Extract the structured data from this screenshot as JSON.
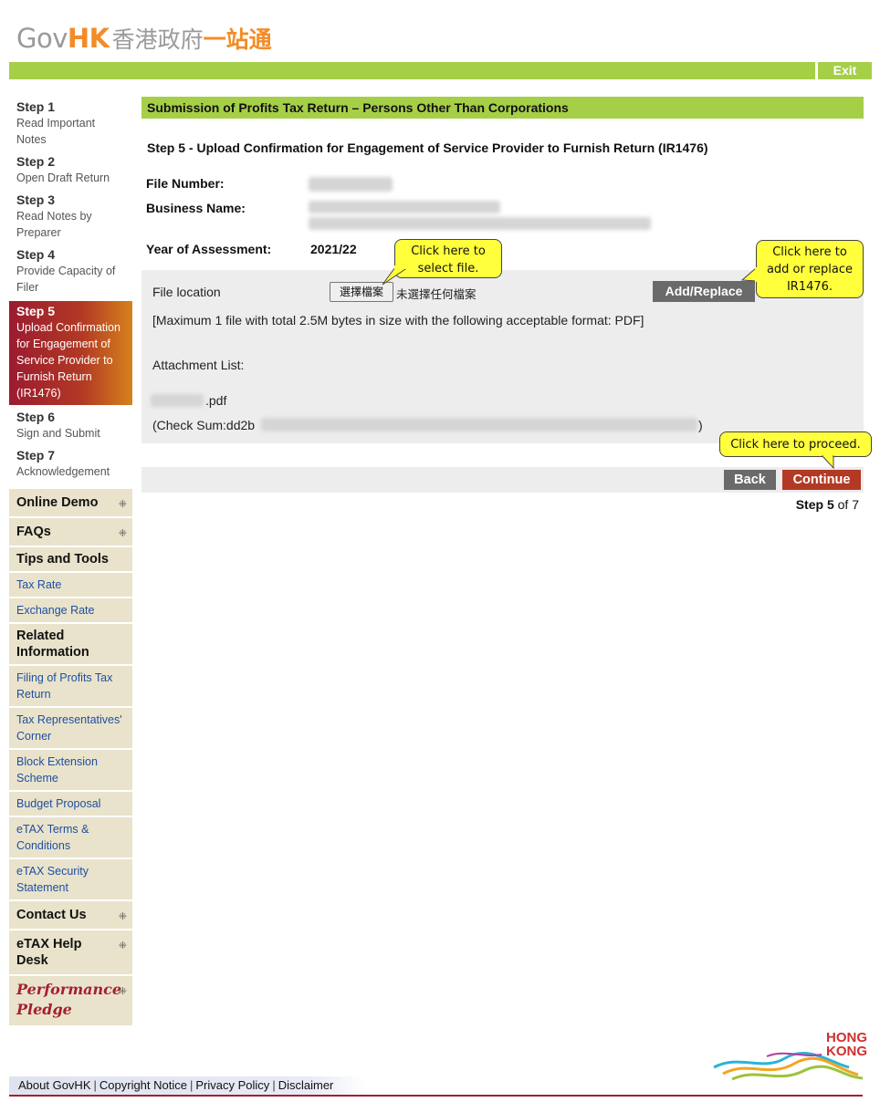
{
  "header": {
    "logo_gov": "Gov",
    "logo_hk": "HK",
    "logo_zh1": "香港政府",
    "logo_zh2": "一站通",
    "exit_label": "Exit"
  },
  "sidebar": {
    "steps": [
      {
        "num": "Step 1",
        "desc": "Read Important Notes"
      },
      {
        "num": "Step 2",
        "desc": "Open Draft Return"
      },
      {
        "num": "Step 3",
        "desc": "Read Notes by Preparer"
      },
      {
        "num": "Step 4",
        "desc": "Provide Capacity of Filer"
      },
      {
        "num": "Step 5",
        "desc": "Upload Confirmation for Engagement of Service Provider to Furnish Return (IR1476)"
      },
      {
        "num": "Step 6",
        "desc": "Sign and Submit"
      },
      {
        "num": "Step 7",
        "desc": "Acknowledgement"
      }
    ],
    "menu": {
      "online_demo": "Online Demo",
      "faqs": "FAQs",
      "tips_tools": "Tips and Tools",
      "tax_rate": "Tax Rate",
      "exchange_rate": "Exchange Rate",
      "related_info": "Related Information",
      "filing_profits": "Filing of Profits Tax Return",
      "tax_rep": "Tax Representatives' Corner",
      "block_ext": "Block Extension Scheme",
      "budget": "Budget Proposal",
      "etax_terms": "eTAX Terms & Conditions",
      "etax_security": "eTAX Security Statement",
      "contact": "Contact Us",
      "help_desk": "eTAX Help Desk",
      "pledge_line1": "Performance",
      "pledge_line2": "Pledge"
    }
  },
  "main": {
    "title": "Submission of Profits Tax Return – Persons Other Than Corporations",
    "step_heading": "Step 5 - Upload Confirmation for Engagement of Service Provider to Furnish Return (IR1476)",
    "file_number_label": "File Number:",
    "business_name_label": "Business Name:",
    "year_label": "Year of Assessment:",
    "year_value": "2021/22",
    "upload": {
      "file_location_label": "File location",
      "choose_file_label": "選擇檔案",
      "no_file_label": "未選擇任何檔案",
      "add_replace_label": "Add/Replace",
      "limit_note": "[Maximum 1 file with total 2.5M bytes in size with the following acceptable format: PDF]",
      "attachment_list_label": "Attachment List:",
      "attachment_ext": ".pdf",
      "checksum_prefix": "(Check Sum:dd2b",
      "checksum_suffix": ")"
    },
    "back_label": "Back",
    "continue_label": "Continue",
    "step_of_prefix": "Step",
    "step_of_current": "5",
    "step_of_suffix": "of 7"
  },
  "callouts": {
    "select_file": "Click here to select file.",
    "add_replace": "Click here to add or replace IR1476.",
    "proceed": "Click here to proceed."
  },
  "footer": {
    "about": "About GovHK",
    "copyright": "Copyright Notice",
    "privacy": "Privacy Policy",
    "disclaimer": "Disclaimer",
    "hk_logo_line1": "HONG",
    "hk_logo_line2": "KONG"
  }
}
